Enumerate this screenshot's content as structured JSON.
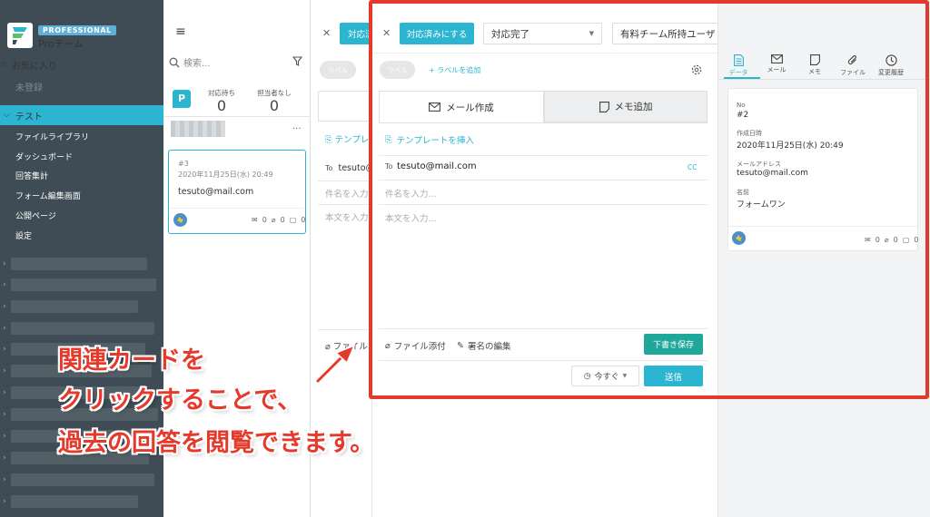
{
  "sidebar": {
    "badge": "PROFESSIONAL",
    "team_name": "Proチーム",
    "favorites_label": "お気に入り",
    "favorites_empty": "未登録",
    "section_label": "テスト",
    "items": [
      {
        "label": "ファイルライブラリ"
      },
      {
        "label": "ダッシュボード"
      },
      {
        "label": "回答集計"
      },
      {
        "label": "フォーム編集画面"
      },
      {
        "label": "公開ページ"
      },
      {
        "label": "設定"
      }
    ]
  },
  "list_panel": {
    "search_placeholder": "検索...",
    "badge_letter": "P",
    "counts": [
      {
        "label": "対応待ち",
        "value": "0"
      },
      {
        "label": "担当者なし",
        "value": "0"
      }
    ],
    "card": {
      "number": "#3",
      "datetime": "2020年11月25日(水) 20:49",
      "email": "tesuto@mail.com",
      "mail_count": "0",
      "file_count": "0",
      "memo_count": "0"
    }
  },
  "mid_panel": {
    "button_partial": "対応済",
    "label_pill": "ラベル",
    "template_partial": "テンプレー",
    "to_label": "To",
    "to_partial": "tesuto@",
    "subject_partial": "件名を入力",
    "body_partial": "本文を入力",
    "attach_partial": "ファイル"
  },
  "main": {
    "mark_done_label": "対応済みにする",
    "status_value": "対応完了",
    "user_value": "有料チーム所持ユーザ",
    "label_pill": "ラベル",
    "add_label": "+ ラベルを追加",
    "tabs": [
      {
        "label": "メール作成",
        "active": true
      },
      {
        "label": "メモ追加",
        "active": false
      }
    ],
    "template_label": "テンプレートを挿入",
    "to_label": "To",
    "to_value": "tesuto@mail.com",
    "cc_label": "CC",
    "subject_placeholder": "件名を入力...",
    "body_placeholder": "本文を入力...",
    "attach_label": "ファイル添付",
    "signature_label": "署名の編集",
    "draft_label": "下書き保存",
    "schedule_label": "今すぐ",
    "send_label": "送信"
  },
  "right": {
    "tabs": [
      {
        "label": "データ",
        "icon": "document-icon",
        "active": true
      },
      {
        "label": "メール",
        "icon": "mail-icon",
        "active": false
      },
      {
        "label": "メモ",
        "icon": "memo-icon",
        "active": false
      },
      {
        "label": "ファイル",
        "icon": "paperclip-icon",
        "active": false
      },
      {
        "label": "変更履歴",
        "icon": "clock-icon",
        "active": false
      }
    ],
    "fields": [
      {
        "label": "No",
        "value": "#2"
      },
      {
        "label": "作成日時",
        "value": "2020年11月25日(水) 20:49"
      },
      {
        "label": "メールアドレス",
        "value": "tesuto@mail.com"
      },
      {
        "label": "名前",
        "value": "フォームワン"
      }
    ],
    "mail_count": "0",
    "file_count": "0",
    "memo_count": "0"
  },
  "annotation": {
    "lines": [
      "関連カードを",
      "クリックすることで、",
      "過去の回答を閲覧できます。"
    ]
  },
  "colors": {
    "accent": "#2bb5d0",
    "sidebar": "#3f4c55",
    "highlight": "#e53a2b",
    "draft_button": "#1fa89a"
  }
}
